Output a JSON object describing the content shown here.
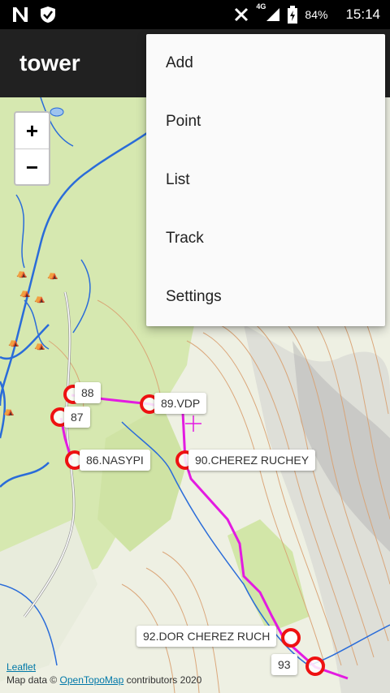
{
  "status_bar": {
    "battery": "84%",
    "network": "4G",
    "time": "15:14",
    "icons": [
      "notification-n-icon",
      "shield-icon",
      "no-sim-icon",
      "signal-icon",
      "battery-icon"
    ]
  },
  "app_bar": {
    "title": "tower"
  },
  "menu": {
    "items": [
      "Add",
      "Point",
      "List",
      "Track",
      "Settings"
    ]
  },
  "map": {
    "zoom_in": "+",
    "zoom_out": "−",
    "markers": [
      "88",
      "87",
      "89.VDP",
      "86.NASYPI",
      "90.CHEREZ RUCHEY",
      "92.DOR CHEREZ RUCH",
      "93"
    ],
    "attribution": {
      "leaflet": "Leaflet",
      "prefix": "Map data © ",
      "source": "OpenTopoMap",
      "suffix": " contributors 2020"
    },
    "colors": {
      "track": "#e31be1",
      "marker_ring": "#ee1111",
      "water": "#2a6cd9",
      "forest": "#d6e8b0",
      "contour": "#d9a070"
    }
  }
}
